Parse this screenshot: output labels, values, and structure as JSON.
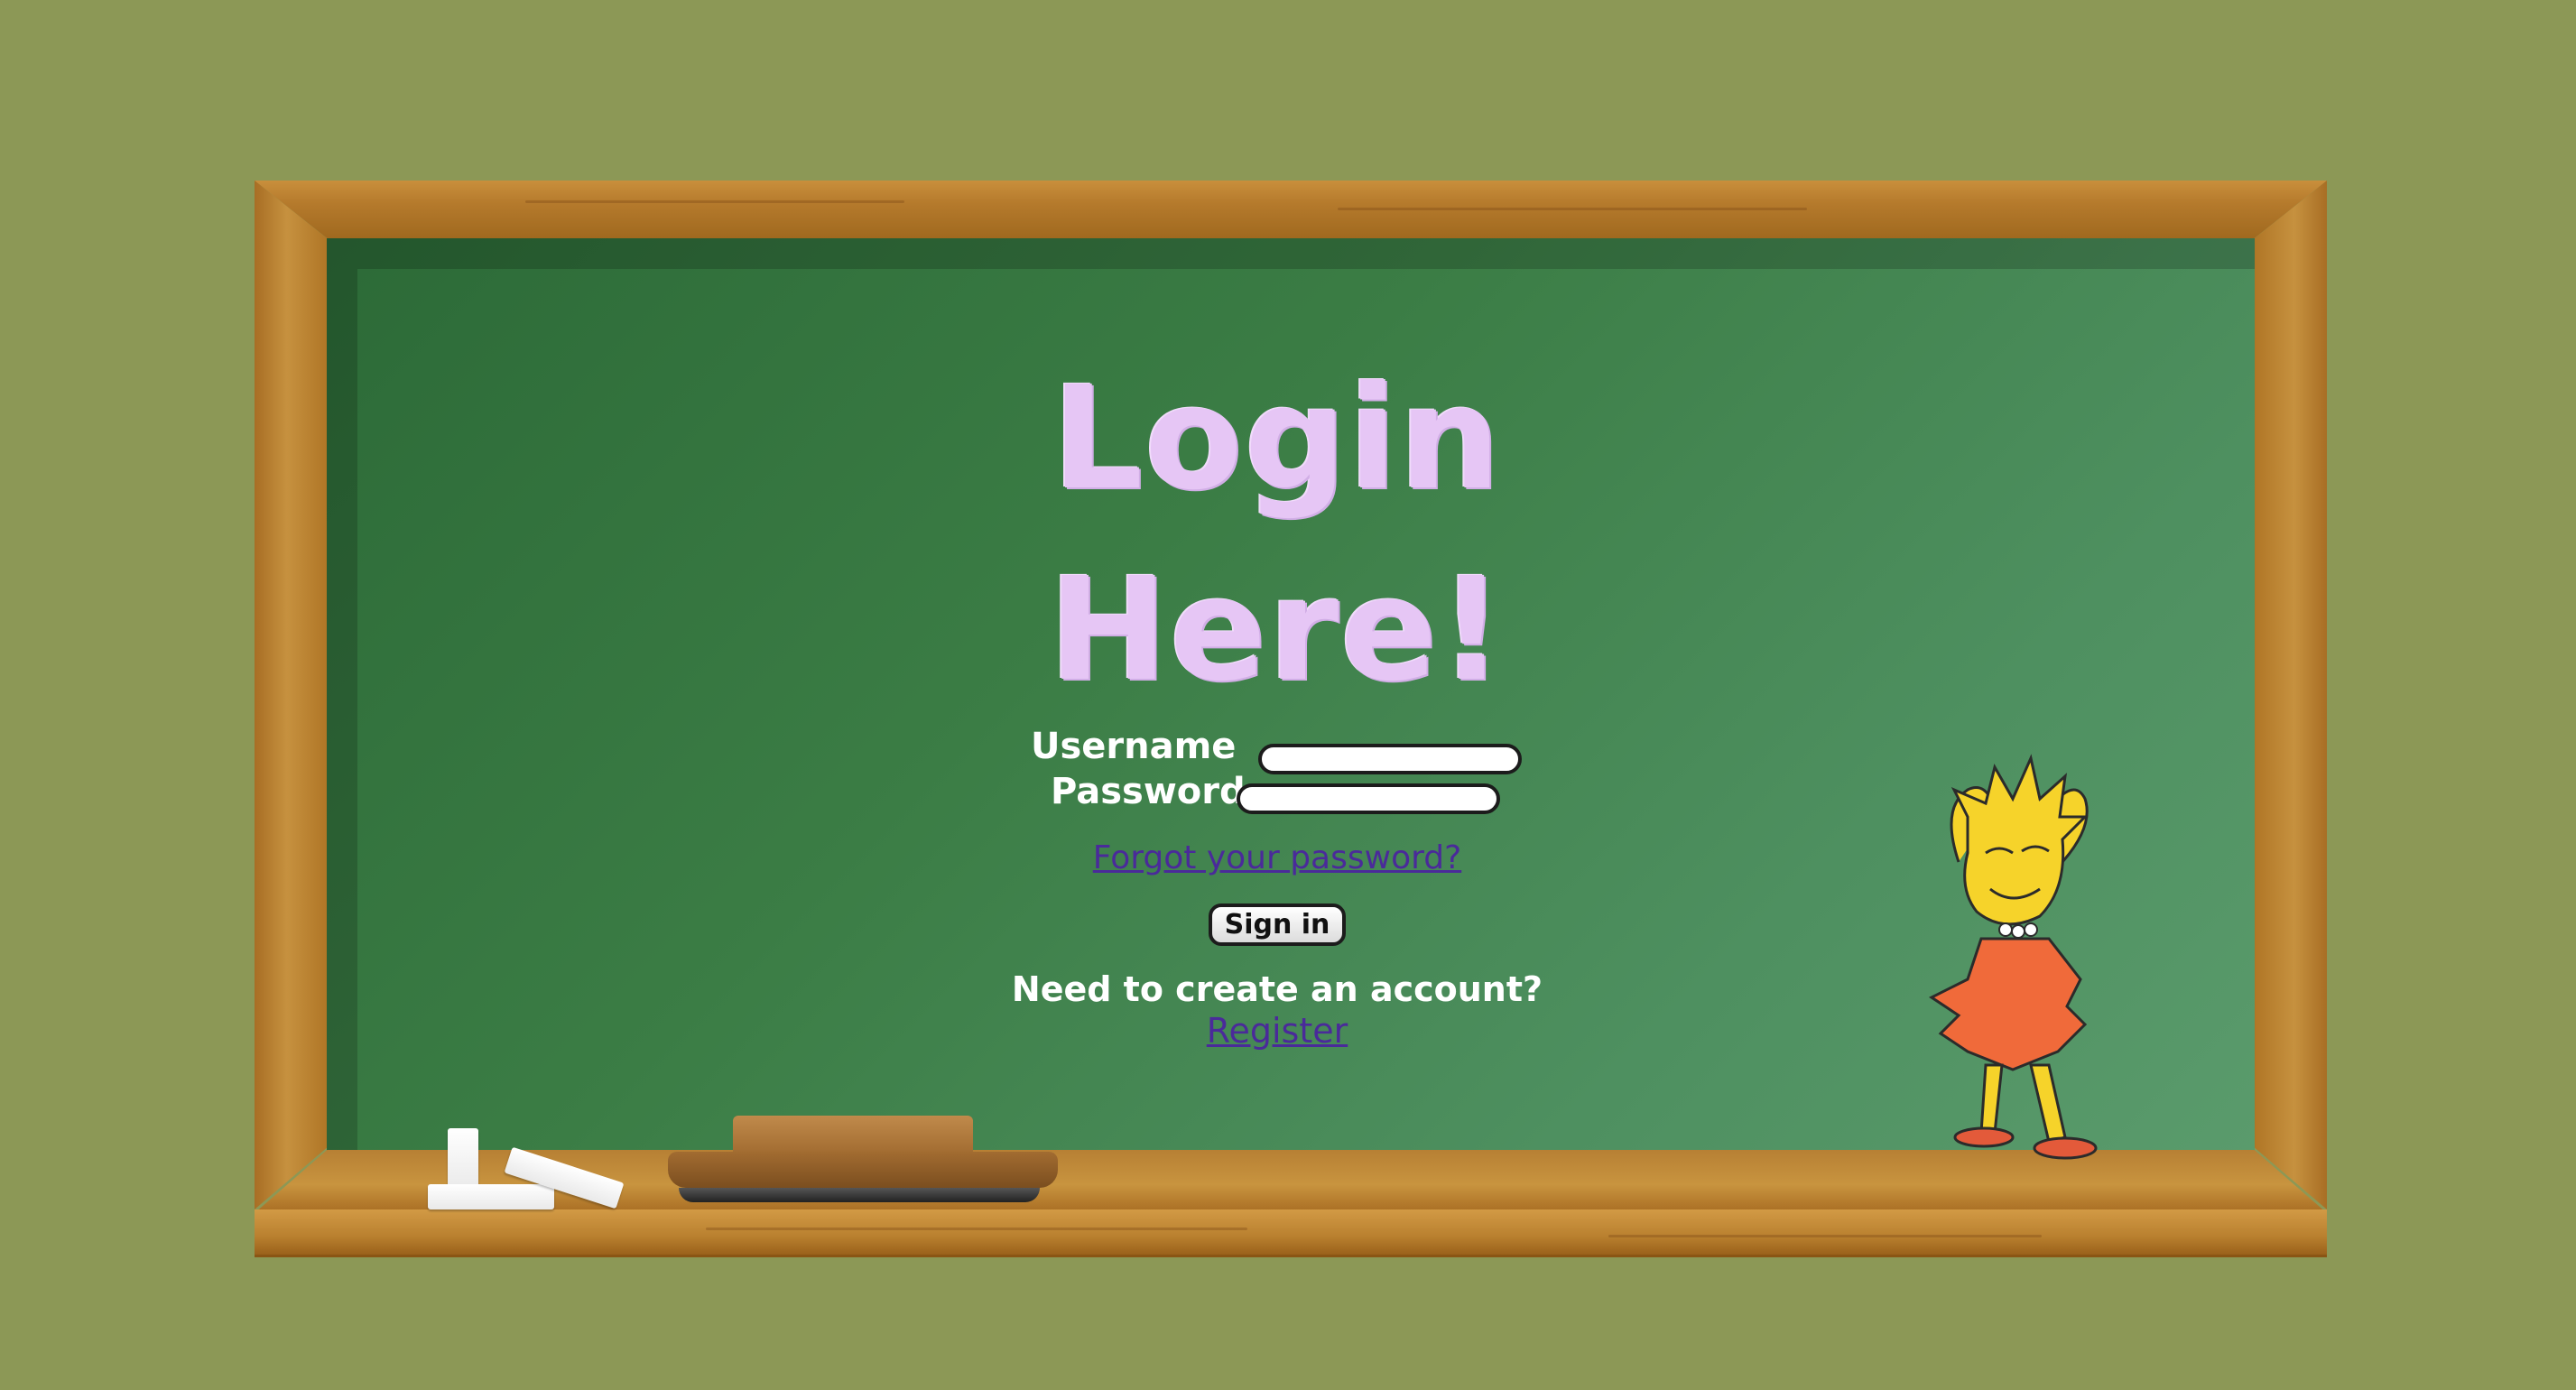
{
  "page": {
    "background_color": "#8c9856",
    "board_color": "#3b7d45",
    "frame_color": "#b9802f"
  },
  "login": {
    "title_line1": "Login",
    "title_line2": "Here!",
    "username_label": "Username",
    "username_value": "",
    "password_label": "Password",
    "password_value": "",
    "forgot_link": "Forgot your password?",
    "signin_button": "Sign in",
    "need_account_text": "Need to create an account?",
    "register_link": "Register",
    "title_color": "#e6c6f5",
    "link_color": "#4a2a9a"
  },
  "decorations": {
    "character_icon": "cartoon-girl-icon",
    "chalk_icon": "chalk-pieces-icon",
    "eraser_icon": "chalkboard-eraser-icon"
  }
}
